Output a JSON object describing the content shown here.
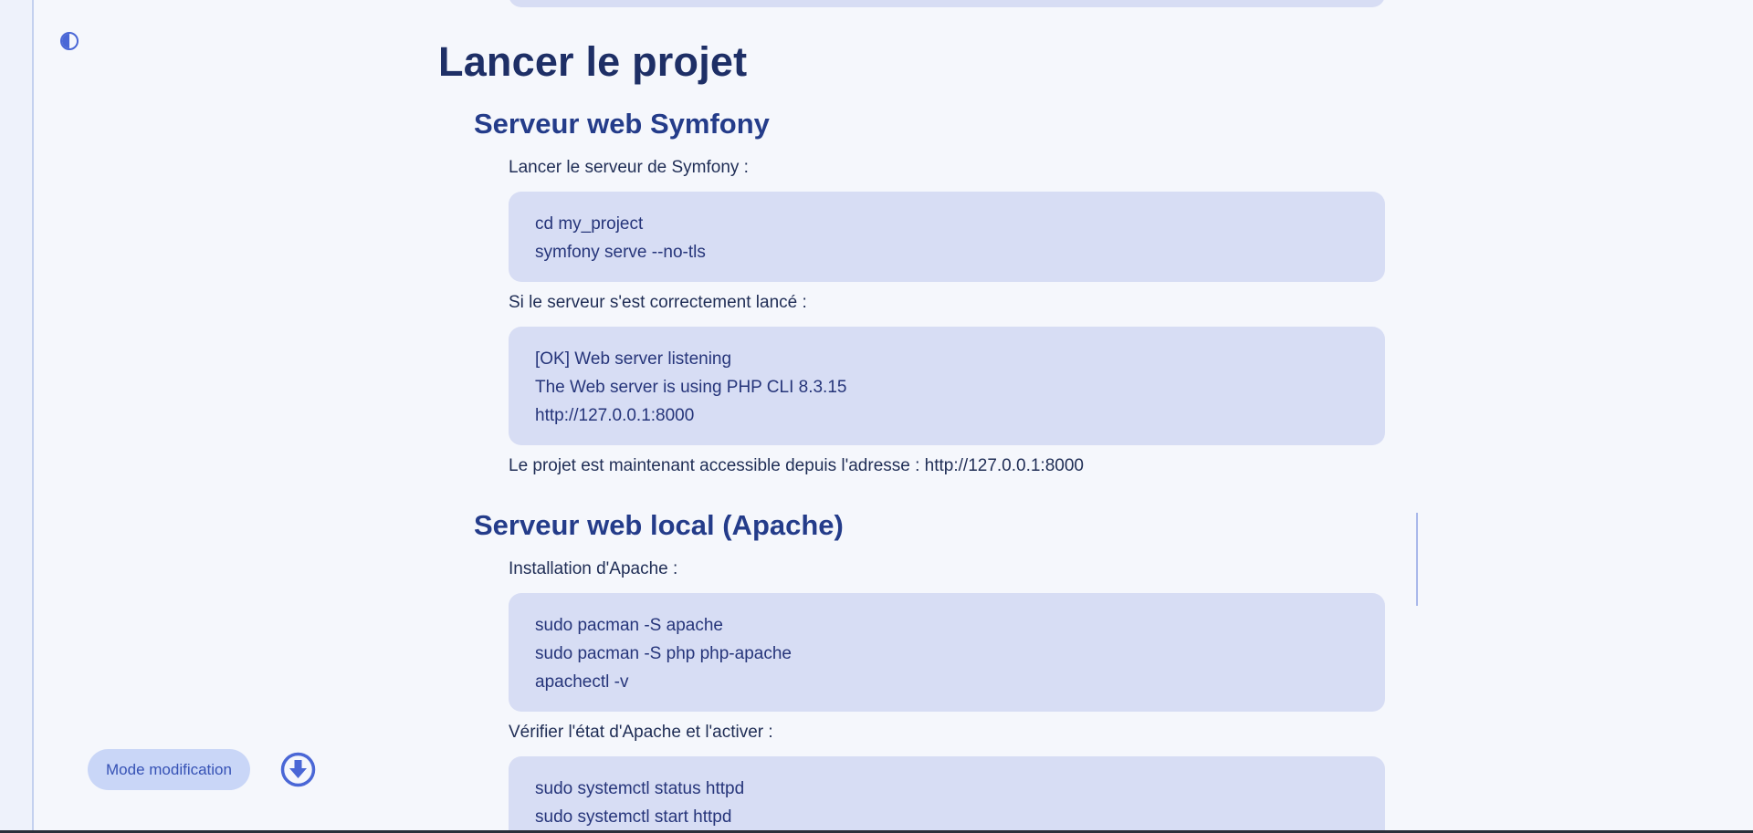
{
  "theme_toggle": {
    "icon": "contrast-icon"
  },
  "main": {
    "title": "Lancer le projet",
    "sections": [
      {
        "heading": "Serveur web Symfony",
        "intro": "Lancer le serveur de Symfony :",
        "code1": [
          "cd my_project",
          "symfony serve --no-tls"
        ],
        "between": "Si le serveur s'est correctement lancé :",
        "code2": [
          "[OK] Web server listening",
          "The Web server is using PHP CLI 8.3.15",
          "http://127.0.0.1:8000"
        ],
        "after": "Le projet est maintenant accessible depuis l'adresse : http://127.0.0.1:8000"
      },
      {
        "heading": "Serveur web local (Apache)",
        "intro": "Installation d'Apache :",
        "code1": [
          "sudo pacman -S apache",
          "sudo pacman -S php php-apache",
          "apachectl -v"
        ],
        "between": "Vérifier l'état d'Apache et l'activer :",
        "code2": [
          "sudo systemctl status httpd",
          "sudo systemctl start httpd"
        ]
      }
    ]
  },
  "footer": {
    "mode_label": "Mode modification",
    "download_icon": "download-icon"
  },
  "colors": {
    "accent": "#4a67d6",
    "heading": "#1e2f66",
    "code_bg": "#d7ddf4",
    "page_bg": "#f5f7fc"
  }
}
